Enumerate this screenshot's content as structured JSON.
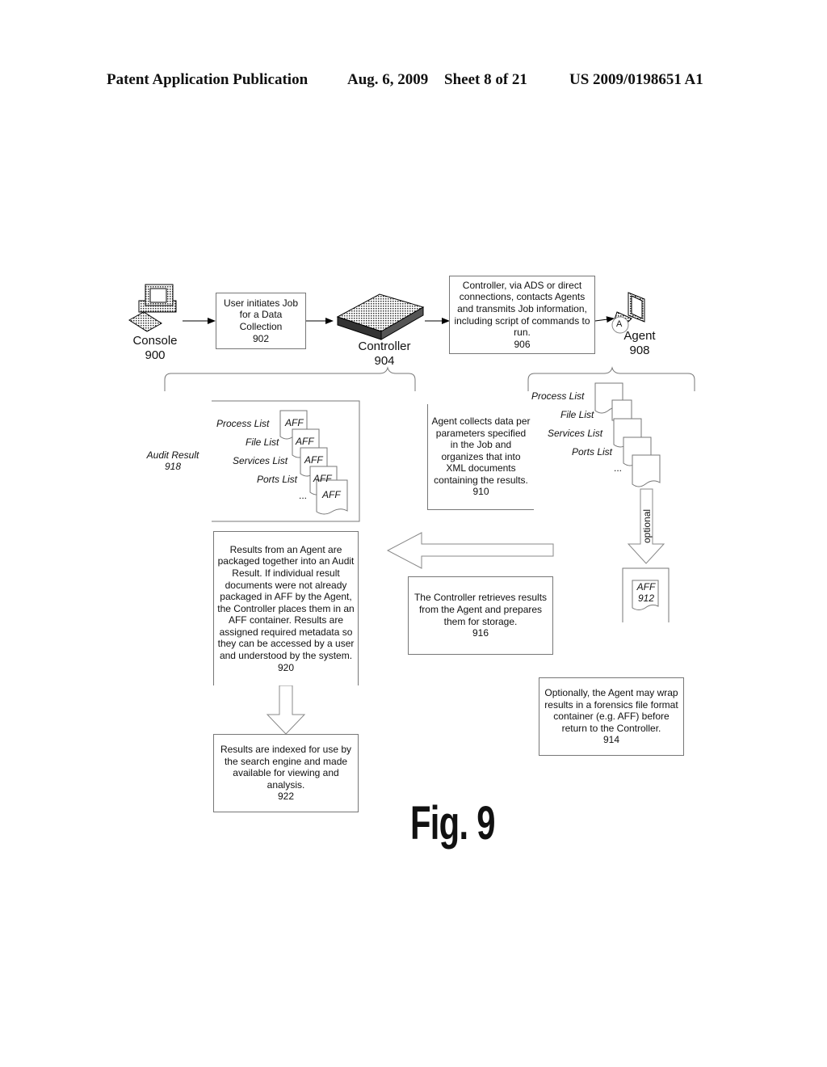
{
  "header": {
    "publication": "Patent Application Publication",
    "date": "Aug. 6, 2009",
    "sheet": "Sheet 8 of 21",
    "number": "US 2009/0198651 A1"
  },
  "nodes": {
    "console": {
      "label": "Console",
      "ref": "900",
      "icon": "desktop-computer-icon"
    },
    "controller": {
      "label": "Controller",
      "ref": "904",
      "icon": "server-appliance-icon"
    },
    "agent": {
      "label": "Agent",
      "ref": "908",
      "icon": "agent-computer-icon",
      "badge": "A"
    }
  },
  "boxes": {
    "b902": {
      "lines": [
        "User initiates Job",
        "for a Data",
        "Collection",
        "902"
      ]
    },
    "b906": {
      "lines": [
        "Controller, via ADS or direct",
        "connections, contacts Agents",
        "and transmits Job information,",
        "including script of commands to",
        "run.",
        "906"
      ]
    },
    "b910": {
      "lines": [
        "Agent collects data per",
        "parameters specified",
        "in the Job and",
        "organizes that into",
        "XML documents",
        "containing the results.",
        "910"
      ]
    },
    "b916": {
      "lines": [
        "The Controller retrieves results",
        "from the Agent and prepares",
        "them for storage.",
        "916"
      ]
    },
    "b920": {
      "lines": [
        "Results from an Agent are",
        "packaged together into an Audit",
        "Result.  If individual result",
        "documents were not already",
        "packaged in AFF by the Agent,",
        "the Controller places them in an",
        "AFF container.  Results are",
        "assigned required metadata so",
        "they can be accessed by a user",
        "and understood by the system.",
        "920"
      ]
    },
    "b922": {
      "lines": [
        "Results are indexed for use by",
        "the search engine and made",
        "available for viewing and",
        "analysis.",
        "922"
      ]
    },
    "b914": {
      "lines": [
        "Optionally, the Agent may wrap",
        "results in a forensics file format",
        "container (e.g. AFF) before",
        "return to the Controller.",
        "914"
      ]
    }
  },
  "audit_result": {
    "label": "Audit Result",
    "ref": "918",
    "lists": [
      "Process List",
      "File List",
      "Services List",
      "Ports List",
      "..."
    ],
    "doc_label": "AFF"
  },
  "agent_results": {
    "lists": [
      "Process List",
      "File List",
      "Services List",
      "Ports List",
      "..."
    ]
  },
  "aff912": {
    "label": "AFF",
    "ref": "912"
  },
  "optional_arrow_label": "optional",
  "figure_label": "Fig. 9"
}
